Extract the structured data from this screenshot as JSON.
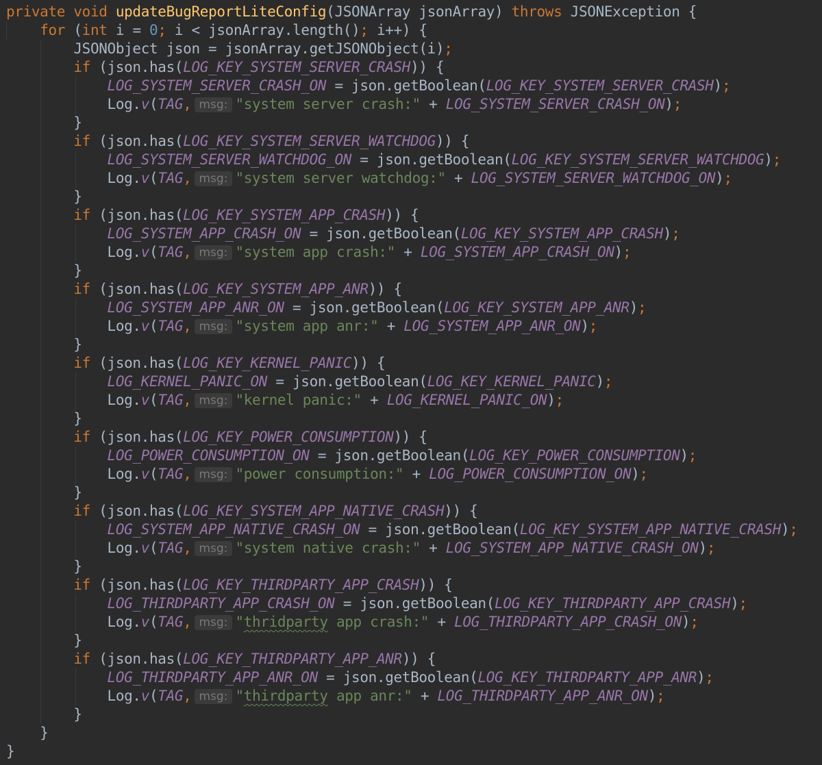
{
  "code": {
    "method_signature": {
      "kw_private": "private",
      "kw_void": "void",
      "method_name": "updateBugReportLiteConfig",
      "param_open": "(JSONArray jsonArray) ",
      "kw_throws": "throws",
      "exception": " JSONException {"
    },
    "for_loop": {
      "kw_for": "for",
      "open": " (",
      "kw_int": "int",
      "init": " i = ",
      "zero": "0",
      "cond": " i < jsonArray.length()",
      "incr": " i++) {"
    },
    "json_line": "JSONObject json = jsonArray.getJSONObject(i)",
    "blocks": [
      {
        "key": "LOG_KEY_SYSTEM_SERVER_CRASH",
        "flag": "LOG_SYSTEM_SERVER_CRASH_ON",
        "message": "\"system server crash:\"",
        "typo_word": ""
      },
      {
        "key": "LOG_KEY_SYSTEM_SERVER_WATCHDOG",
        "flag": "LOG_SYSTEM_SERVER_WATCHDOG_ON",
        "message": "\"system server watchdog:\"",
        "typo_word": ""
      },
      {
        "key": "LOG_KEY_SYSTEM_APP_CRASH",
        "flag": "LOG_SYSTEM_APP_CRASH_ON",
        "message": "\"system app crash:\"",
        "typo_word": ""
      },
      {
        "key": "LOG_KEY_SYSTEM_APP_ANR",
        "flag": "LOG_SYSTEM_APP_ANR_ON",
        "message": "\"system app anr:\"",
        "typo_word": ""
      },
      {
        "key": "LOG_KEY_KERNEL_PANIC",
        "flag": "LOG_KERNEL_PANIC_ON",
        "message": "\"kernel panic:\"",
        "typo_word": ""
      },
      {
        "key": "LOG_KEY_POWER_CONSUMPTION",
        "flag": "LOG_POWER_CONSUMPTION_ON",
        "message": "\"power consumption:\"",
        "typo_word": ""
      },
      {
        "key": "LOG_KEY_SYSTEM_APP_NATIVE_CRASH",
        "flag": "LOG_SYSTEM_APP_NATIVE_CRASH_ON",
        "message": "\"system native crash:\"",
        "typo_word": ""
      },
      {
        "key": "LOG_KEY_THIRDPARTY_APP_CRASH",
        "flag": "LOG_THIRDPARTY_APP_CRASH_ON",
        "message": "\"thridparty app crash:\"",
        "typo_word": "thridparty"
      },
      {
        "key": "LOG_KEY_THIRDPARTY_APP_ANR",
        "flag": "LOG_THIRDPARTY_APP_ANR_ON",
        "message": "\"thirdparty app anr:\"",
        "typo_word": "thirdparty"
      }
    ],
    "tokens": {
      "kw_if": "if",
      "has_open": " (json.has(",
      "has_close": ")) {",
      "assign": " = json.getBoolean(",
      "call_close": ")",
      "semicolon": ";",
      "log_prefix": "Log.",
      "log_method": "v",
      "log_open": "(",
      "tag": "TAG",
      "comma": ",",
      "hint_label": "msg:",
      "concat": " + ",
      "brace_close": "}"
    },
    "line_count": 41
  },
  "colors": {
    "background": "#2b2b2b",
    "default_text": "#a9b7c6",
    "keyword": "#cc7832",
    "method_declaration": "#ffc66d",
    "number": "#6897bb",
    "static_field": "#9876aa",
    "string": "#6a8759",
    "hint_background": "#3b3b3b",
    "hint_text": "#787878"
  }
}
